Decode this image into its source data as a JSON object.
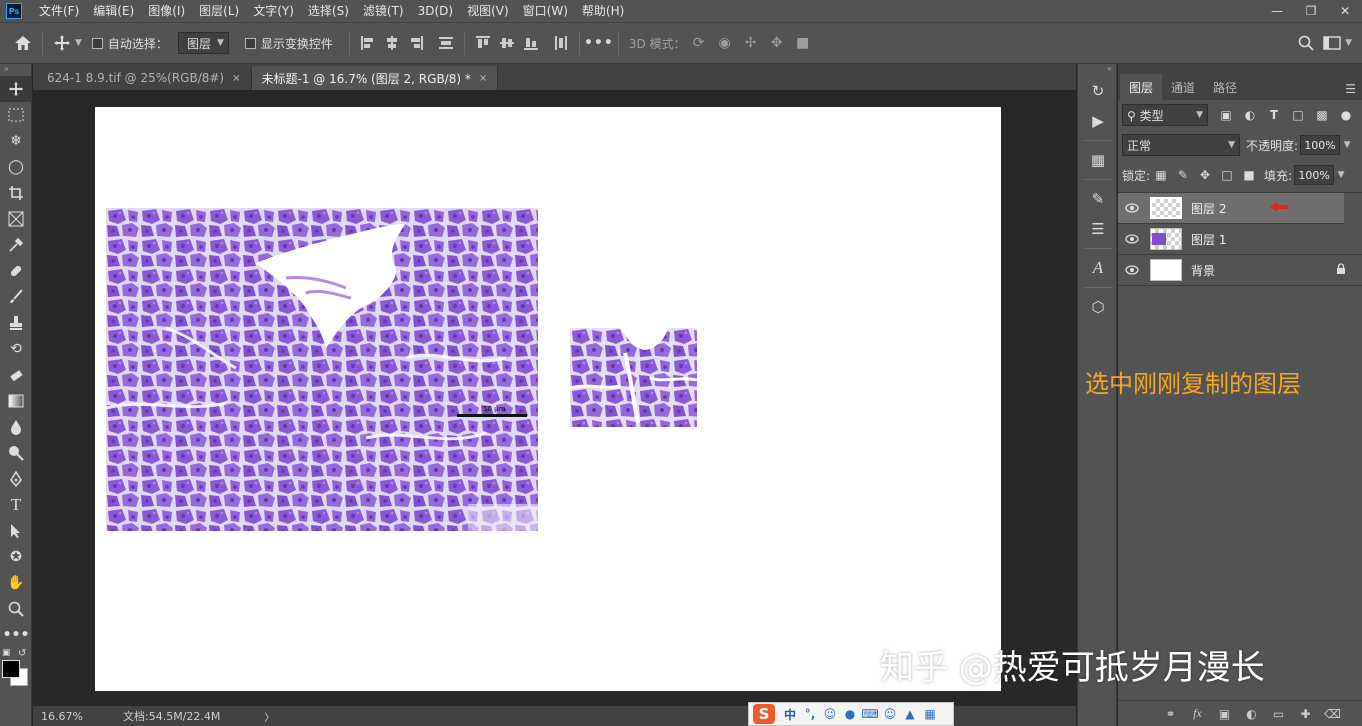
{
  "app": {
    "logo": "Ps"
  },
  "menu": [
    "文件(F)",
    "编辑(E)",
    "图像(I)",
    "图层(L)",
    "文字(Y)",
    "选择(S)",
    "滤镜(T)",
    "3D(D)",
    "视图(V)",
    "窗口(W)",
    "帮助(H)"
  ],
  "options_bar": {
    "auto_select_label": "自动选择：",
    "auto_select_target": "图层",
    "show_transform_label": "显示变换控件",
    "mode_3d_label": "3D 模式："
  },
  "tabs": [
    {
      "label": "624-1 8.9.tif @ 25%(RGB/8#)",
      "close": "×"
    },
    {
      "label": "未标题-1 @ 16.7% (图层 2, RGB/8) *",
      "close": "×"
    }
  ],
  "canvas": {
    "scale_bar_label": "50 μm"
  },
  "status": {
    "zoom": "16.67%",
    "doc_size": "文档:54.5M/22.4M",
    "arrow": "〉"
  },
  "ime": {
    "logo": "S",
    "mode": "中"
  },
  "panel": {
    "tabs": [
      "图层",
      "通道",
      "路径"
    ],
    "kind_filter": "类型",
    "blend_mode": "正常",
    "opacity_label": "不透明度:",
    "opacity_value": "100%",
    "lock_label": "锁定:",
    "fill_label": "填充:",
    "fill_value": "100%",
    "layers": [
      {
        "name": "图层 2",
        "selected": true
      },
      {
        "name": "图层 1",
        "selected": false
      },
      {
        "name": "背景",
        "selected": false
      }
    ]
  },
  "annotation": "选中刚刚复制的图层",
  "watermark": "知乎 @热爱可抵岁月漫长",
  "colors": {
    "accent_annotation": "#f6a623",
    "arrow_red": "#e02424",
    "tissue_purple": "#8a4ccf"
  }
}
